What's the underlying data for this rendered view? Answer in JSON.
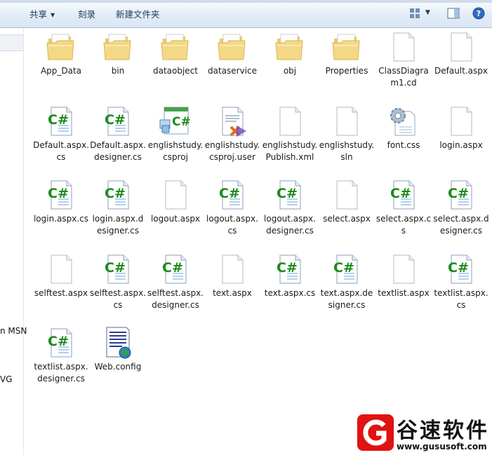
{
  "toolbar": {
    "share_label": "共享",
    "burn_label": "刻录",
    "new_folder_label": "新建文件夹"
  },
  "sidebar": {
    "items": [
      {
        "label": "n MSN"
      },
      {
        "label": "VG"
      }
    ]
  },
  "files": [
    {
      "name": "App_Data",
      "icon": "folder-icon"
    },
    {
      "name": "bin",
      "icon": "folder-icon"
    },
    {
      "name": "dataobject",
      "icon": "folder-icon"
    },
    {
      "name": "dataservice",
      "icon": "folder-icon"
    },
    {
      "name": "obj",
      "icon": "folder-icon"
    },
    {
      "name": "Properties",
      "icon": "folder-icon"
    },
    {
      "name": "ClassDiagram1.cd",
      "icon": "blank-file-icon"
    },
    {
      "name": "Default.aspx",
      "icon": "blank-file-icon"
    },
    {
      "name": "Default.aspx.cs",
      "icon": "csharp-file-icon"
    },
    {
      "name": "Default.aspx.designer.cs",
      "icon": "csharp-file-icon"
    },
    {
      "name": "englishstudy.csproj",
      "icon": "csharp-project-icon"
    },
    {
      "name": "englishstudy.csproj.user",
      "icon": "project-user-file-icon"
    },
    {
      "name": "englishstudy.Publish.xml",
      "icon": "blank-file-icon"
    },
    {
      "name": "englishstudy.sln",
      "icon": "blank-file-icon"
    },
    {
      "name": "font.css",
      "icon": "css-gear-file-icon"
    },
    {
      "name": "login.aspx",
      "icon": "blank-file-icon"
    },
    {
      "name": "login.aspx.cs",
      "icon": "csharp-file-icon"
    },
    {
      "name": "login.aspx.designer.cs",
      "icon": "csharp-file-icon"
    },
    {
      "name": "logout.aspx",
      "icon": "blank-file-icon"
    },
    {
      "name": "logout.aspx.cs",
      "icon": "csharp-file-icon"
    },
    {
      "name": "logout.aspx.designer.cs",
      "icon": "csharp-file-icon"
    },
    {
      "name": "select.aspx",
      "icon": "blank-file-icon"
    },
    {
      "name": "select.aspx.cs",
      "icon": "csharp-file-icon"
    },
    {
      "name": "select.aspx.designer.cs",
      "icon": "csharp-file-icon"
    },
    {
      "name": "selftest.aspx",
      "icon": "blank-file-icon"
    },
    {
      "name": "selftest.aspx.cs",
      "icon": "csharp-file-icon"
    },
    {
      "name": "selftest.aspx.designer.cs",
      "icon": "csharp-file-icon"
    },
    {
      "name": "text.aspx",
      "icon": "blank-file-icon"
    },
    {
      "name": "text.aspx.cs",
      "icon": "csharp-file-icon"
    },
    {
      "name": "text.aspx.designer.cs",
      "icon": "csharp-file-icon"
    },
    {
      "name": "textlist.aspx",
      "icon": "blank-file-icon"
    },
    {
      "name": "textlist.aspx.cs",
      "icon": "csharp-file-icon"
    },
    {
      "name": "textlist.aspx.designer.cs",
      "icon": "csharp-file-icon"
    },
    {
      "name": "Web.config",
      "icon": "config-file-icon"
    }
  ],
  "watermark": {
    "title": "谷速软件",
    "url": "www.gususoft.com"
  }
}
